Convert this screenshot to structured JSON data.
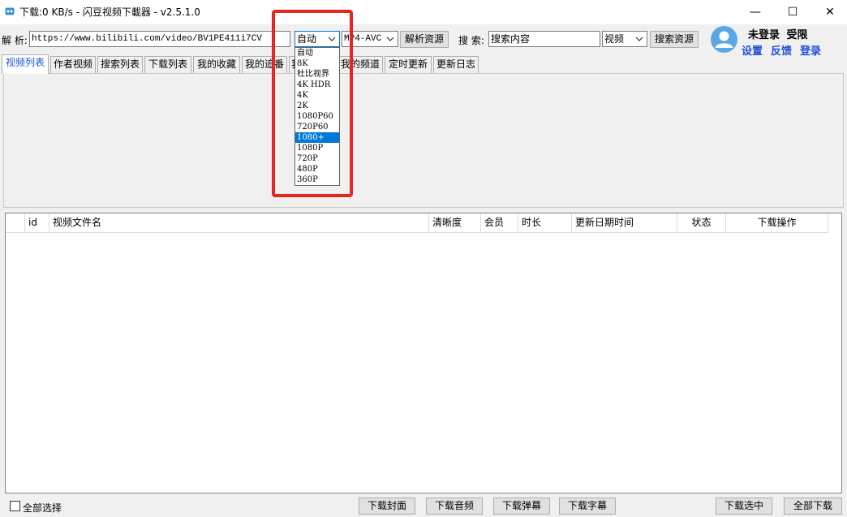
{
  "window": {
    "title": "下载:0 KB/s - 闪豆视频下載器 - v2.5.1.0",
    "minimize_glyph": "—",
    "maximize_glyph": "☐",
    "close_glyph": "✕"
  },
  "toolbar": {
    "parse_label": "解 析:",
    "url_value": "https://www.bilibili.com/video/BV1PE411i7CV",
    "quality_selected": "自动",
    "codec_selected": "MP4-AVC",
    "parse_button": "解析资源",
    "search_label": "搜 索:",
    "search_placeholder": "搜索内容",
    "search_type_selected": "视频",
    "search_button": "搜索资源"
  },
  "account": {
    "status": "未登录",
    "limit": "受限",
    "settings_link": "设置",
    "feedback_link": "反馈",
    "login_link": "登录"
  },
  "tabs": [
    {
      "label": "视频列表"
    },
    {
      "label": "作者视频"
    },
    {
      "label": "搜索列表"
    },
    {
      "label": "下载列表"
    },
    {
      "label": "我的收藏"
    },
    {
      "label": "我的追番"
    },
    {
      "label": "我"
    },
    {
      "label": "我的频道"
    },
    {
      "label": "定时更新"
    },
    {
      "label": "更新日志"
    }
  ],
  "quality_dropdown": {
    "options": [
      "自动",
      "8K",
      "杜比视界",
      "4K HDR",
      "4K",
      "2K",
      "1080P60",
      "720P60",
      "1080+",
      "1080P",
      "720P",
      "480P",
      "360P"
    ],
    "highlighted_index": 8
  },
  "table": {
    "columns": [
      "",
      "id",
      "视频文件名",
      "清晰度",
      "会员",
      "时长",
      "更新日期时间",
      "状态",
      "下载操作"
    ],
    "rows": []
  },
  "bottom": {
    "select_all": "全部选择",
    "download_cover": "下载封面",
    "download_audio": "下载音频",
    "download_danmaku": "下载弹幕",
    "download_subtitle": "下载字幕",
    "download_selected": "下载选中",
    "download_all": "全部下载"
  },
  "colors": {
    "accent_link": "#1f4fd6",
    "highlight_box": "#e8261f",
    "selected_option": "#0078d7",
    "avatar": "#5aa7e6"
  }
}
